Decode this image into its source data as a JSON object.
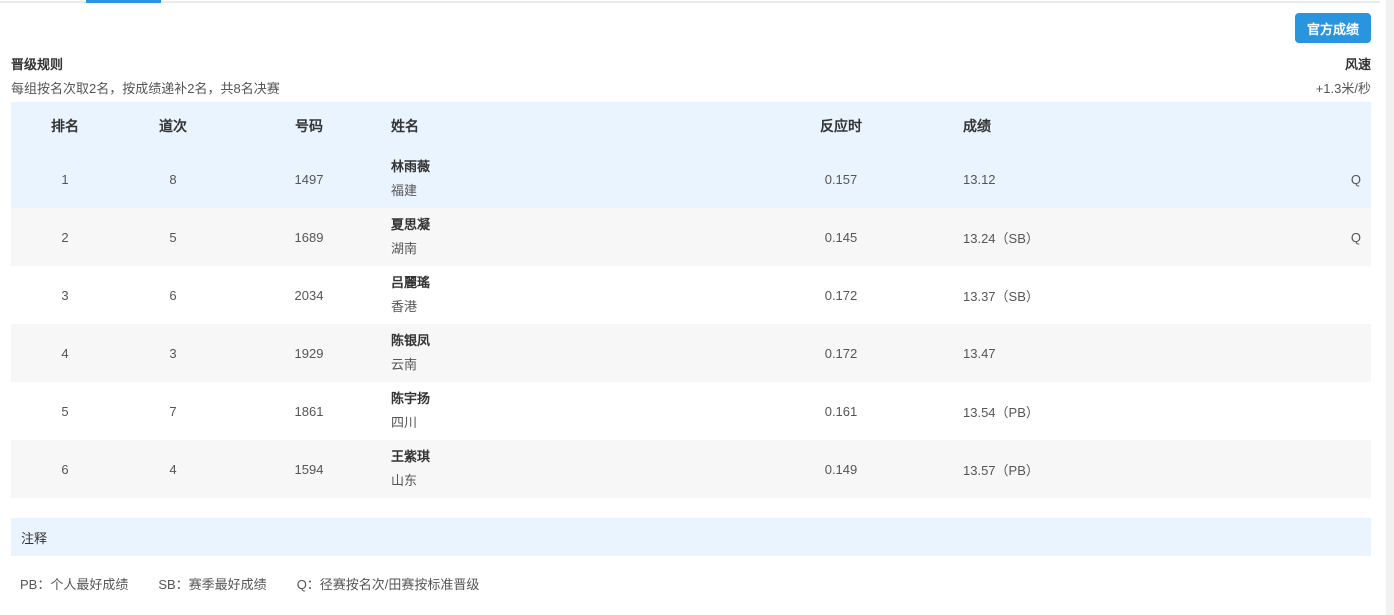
{
  "official_button": "官方成绩",
  "rules": {
    "title": "晋级规则",
    "text": "每组按名次取2名，按成绩递补2名，共8名决赛"
  },
  "wind": {
    "title": "风速",
    "value": "+1.3米/秒"
  },
  "table": {
    "headers": {
      "rank": "排名",
      "lane": "道次",
      "bib": "号码",
      "name": "姓名",
      "reaction": "反应时",
      "result": "成绩"
    },
    "rows": [
      {
        "rank": "1",
        "lane": "8",
        "bib": "1497",
        "name": "林雨薇",
        "team": "福建",
        "reaction": "0.157",
        "result": "13.12",
        "q": "Q"
      },
      {
        "rank": "2",
        "lane": "5",
        "bib": "1689",
        "name": "夏思凝",
        "team": "湖南",
        "reaction": "0.145",
        "result": "13.24（SB）",
        "q": "Q"
      },
      {
        "rank": "3",
        "lane": "6",
        "bib": "2034",
        "name": "吕麗瑤",
        "team": "香港",
        "reaction": "0.172",
        "result": "13.37（SB）",
        "q": ""
      },
      {
        "rank": "4",
        "lane": "3",
        "bib": "1929",
        "name": "陈银凤",
        "team": "云南",
        "reaction": "0.172",
        "result": "13.47",
        "q": ""
      },
      {
        "rank": "5",
        "lane": "7",
        "bib": "1861",
        "name": "陈宇扬",
        "team": "四川",
        "reaction": "0.161",
        "result": "13.54（PB）",
        "q": ""
      },
      {
        "rank": "6",
        "lane": "4",
        "bib": "1594",
        "name": "王紫琪",
        "team": "山东",
        "reaction": "0.149",
        "result": "13.57（PB）",
        "q": ""
      }
    ]
  },
  "notes": {
    "title": "注释",
    "items": [
      "PB：个人最好成绩",
      "SB：赛季最好成绩",
      "Q：径赛按名次/田赛按标准晋级"
    ]
  },
  "colors": {
    "accent": "#2a95df",
    "header_bg": "#eaf4fe",
    "stripe_bg": "#f7f7f7"
  }
}
